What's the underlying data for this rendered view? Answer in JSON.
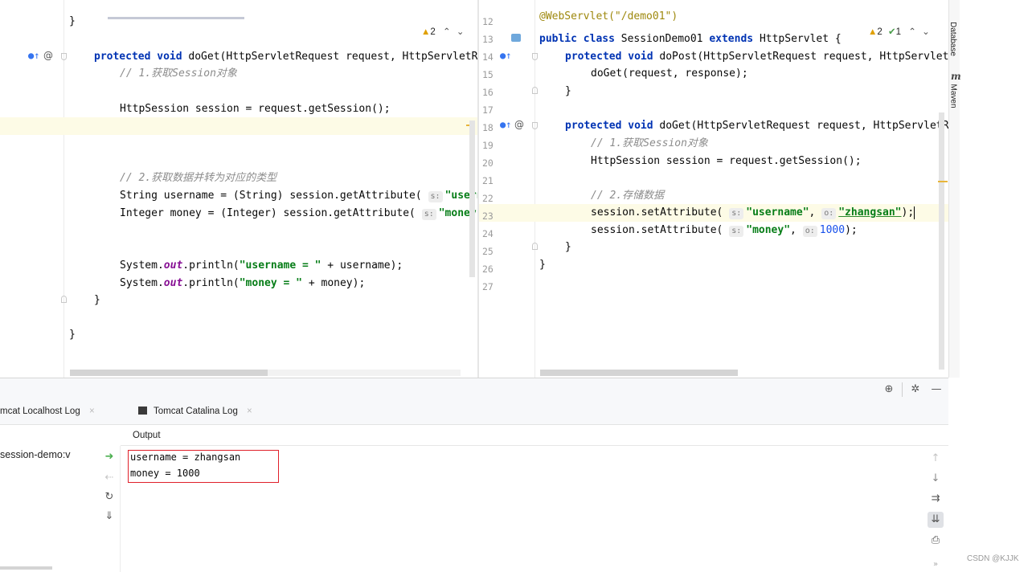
{
  "left_editor": {
    "inspection": {
      "warnings": "2"
    },
    "lines": [
      {
        "text": "}"
      },
      {
        "kw1": "protected void",
        "name": " doGet(HttpServletRequest request, HttpServletR"
      },
      {
        "comment": "// 1.获取Session对象"
      },
      {
        "text": "HttpSession session = request.getSession();"
      },
      {
        "comment": "// 2.获取数据并转为对应的类型"
      },
      {
        "pre": "String username = (String) session.getAttribute(",
        "hint": "s:",
        "str": "\"usern"
      },
      {
        "pre": "Integer money = (Integer) session.getAttribute(",
        "hint": "s:",
        "str": "\"money\""
      },
      {
        "a": "System.",
        "fld": "out",
        "b": ".println(",
        "str": "\"username = \"",
        "c": " + username);"
      },
      {
        "a": "System.",
        "fld": "out",
        "b": ".println(",
        "str": "\"money = \"",
        "c": " + money);"
      },
      {
        "text": "}"
      },
      {
        "text": "}"
      }
    ]
  },
  "right_editor": {
    "inspection": {
      "warnings": "2",
      "weak": "1"
    },
    "line_numbers": [
      "12",
      "13",
      "14",
      "15",
      "16",
      "17",
      "18",
      "19",
      "20",
      "21",
      "22",
      "23",
      "24",
      "25",
      "26",
      "27"
    ],
    "annotation": "@WebServlet(\"/demo01\")",
    "class_decl": {
      "kw": "public class",
      "name": " SessionDemo01 ",
      "kw2": "extends",
      "rest": " HttpServlet {"
    },
    "dopost": {
      "kw": "protected void",
      "rest": " doPost(HttpServletRequest request, HttpServletRe"
    },
    "dopost_body": "doGet(request, response);",
    "close1": "}",
    "doget": {
      "kw": "protected void",
      "rest": " doGet(HttpServletRequest request, HttpServletR"
    },
    "comment1": "// 1.获取Session对象",
    "session_line": "HttpSession session = request.getSession();",
    "comment2": "// 2.存储数据",
    "set1": {
      "pre": "session.setAttribute(",
      "hint1": "s:",
      "key": "\"username\"",
      "sep": ", ",
      "hint2": "o:",
      "val": "\"zhangsan\"",
      "post": ");"
    },
    "set2": {
      "pre": "session.setAttribute(",
      "hint1": "s:",
      "key": "\"money\"",
      "sep": ", ",
      "hint2": "o:",
      "val": "1000",
      "post": ");"
    },
    "close2": "}",
    "close3": "}"
  },
  "right_side_tabs": {
    "database": "Database",
    "maven": "Maven",
    "maven_icon": "m"
  },
  "services": {
    "tabs": [
      {
        "label": "mcat Localhost Log"
      },
      {
        "label": "Tomcat Catalina Log"
      }
    ],
    "output_header": "Output",
    "tree_item": "session-demo:v",
    "output_lines": [
      "username = zhangsan",
      "money = 1000"
    ],
    "icons": [
      "rerun-icon",
      "stop-icon",
      "restart-icon",
      "dump-icon"
    ],
    "right_icons": [
      "up-arrow-icon",
      "down-arrow-icon",
      "soft-wrap-icon",
      "scroll-to-end-icon",
      "print-icon"
    ]
  },
  "watermark": "CSDN @KJJK"
}
